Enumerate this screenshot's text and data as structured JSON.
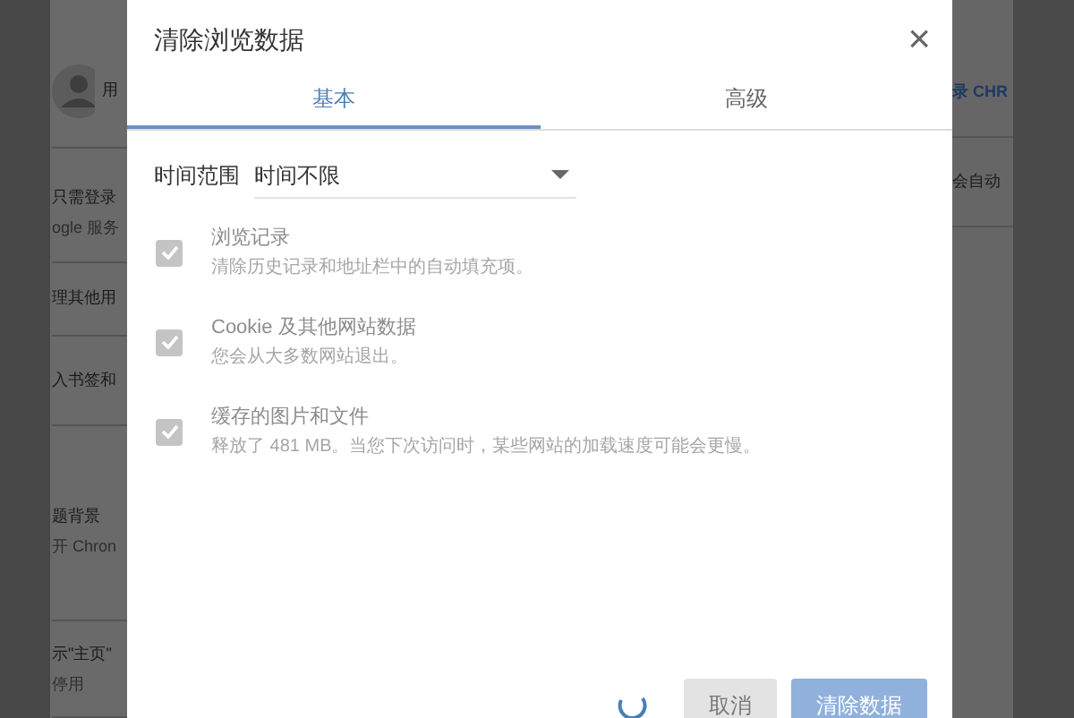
{
  "background_page": {
    "left_items": [
      {
        "lines": [
          "用"
        ],
        "kind": "avatar"
      },
      {
        "lines": [
          "只需登录",
          "ogle 服务"
        ],
        "kind": "text"
      },
      {
        "lines": [
          "理其他用"
        ],
        "kind": "text"
      },
      {
        "lines": [
          "入书签和"
        ],
        "kind": "text"
      },
      {
        "lines": [
          "题背景",
          "开 Chron"
        ],
        "kind": "text"
      },
      {
        "lines": [
          "示\"主页\"",
          "停用"
        ],
        "kind": "text"
      }
    ],
    "right_items": [
      "录 CHR",
      "会自动"
    ]
  },
  "dialog": {
    "title": "清除浏览数据",
    "close": "×",
    "tabs": [
      {
        "label": "基本",
        "selected": true
      },
      {
        "label": "高级",
        "selected": false
      }
    ],
    "time_range": {
      "label": "时间范围",
      "value": "时间不限"
    },
    "options": [
      {
        "title": "浏览记录",
        "description": "清除历史记录和地址栏中的自动填充项。",
        "checked": true
      },
      {
        "title": "Cookie 及其他网站数据",
        "description": "您会从大多数网站退出。",
        "checked": true
      },
      {
        "title": "缓存的图片和文件",
        "description": "释放了 481 MB。当您下次访问时，某些网站的加载速度可能会更慢。",
        "checked": true
      }
    ],
    "busy": true,
    "buttons": [
      {
        "label": "取消",
        "kind": "secondary",
        "disabled": false
      },
      {
        "label": "清除数据",
        "kind": "primary",
        "disabled": true
      }
    ]
  }
}
